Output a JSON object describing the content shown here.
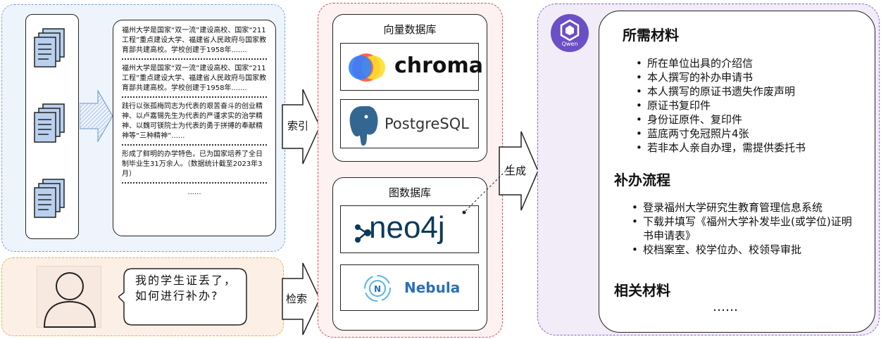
{
  "chunks": [
    "福州大学是国家“双一流”建设高校、国家“211工程”重点建设大学、福建省人民政府与国家教育部共建高校。学校创建于1958年.......",
    "福州大学是国家“双一流”建设高校、国家“211工程”重点建设大学、福建省人民政府与国家教育部共建高校。学校创建于1958年.......",
    "践行以张孤梅同志为代表的艰苦奋斗的创业精神、以卢嘉锡先生为代表的严谨求实的治学精神、以魏可镁院士为代表的勇于拼搏的奉献精神等“三种精神”......",
    "形成了鲜明的办学特色，已为国家培养了全日制毕业生31万余人。（数据统计截至2023年3月）",
    "......"
  ],
  "query": "我的学生证丢了，如何进行补办?",
  "labels": {
    "index": "索引",
    "retrieve": "检索",
    "generate": "生成"
  },
  "vector_db": {
    "title": "向量数据库",
    "logos": [
      "chroma",
      "PostgreSQL"
    ]
  },
  "graph_db": {
    "title": "图数据库",
    "logos": [
      "neo4j",
      "Nebula"
    ]
  },
  "qwen_label": "Qwen",
  "answer": {
    "sections": [
      {
        "title": "所需材料",
        "items": [
          "所在单位出具的介绍信",
          "本人撰写的补办申请书",
          "本人撰写的原证书遗失作废声明",
          "原证书复印件",
          "身份证原件、复印件",
          "蓝底两寸免冠照片4张",
          "若非本人亲自办理，需提供委托书"
        ]
      },
      {
        "title": "补办流程",
        "items": [
          "登录福州大学研究生教育管理信息系统",
          "下载并填写《福州大学补发毕业(或学位)证明书申请表》",
          "校档案室、校学位办、校领导审批"
        ]
      },
      {
        "title": "相关材料",
        "items": []
      }
    ],
    "ellipsis": "……"
  },
  "colors": {
    "docs_border": "#7ea0d6",
    "query_border": "#e0b443",
    "db_border": "#d94e4e",
    "right_border": "#8a66c2",
    "qwen": "#6b4fc7"
  }
}
